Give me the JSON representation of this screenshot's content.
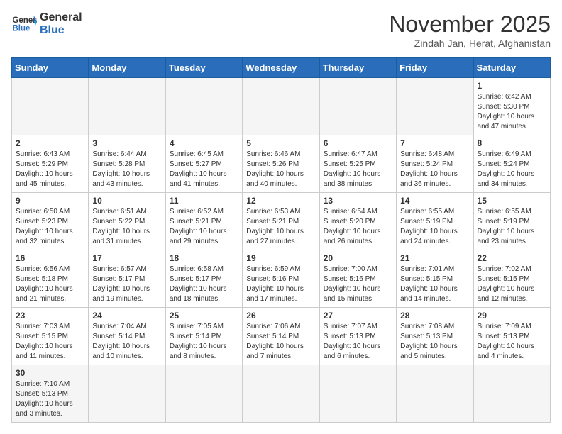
{
  "logo": {
    "line1": "General",
    "line2": "Blue"
  },
  "title": "November 2025",
  "subtitle": "Zindah Jan, Herat, Afghanistan",
  "weekdays": [
    "Sunday",
    "Monday",
    "Tuesday",
    "Wednesday",
    "Thursday",
    "Friday",
    "Saturday"
  ],
  "weeks": [
    [
      {
        "day": "",
        "info": ""
      },
      {
        "day": "",
        "info": ""
      },
      {
        "day": "",
        "info": ""
      },
      {
        "day": "",
        "info": ""
      },
      {
        "day": "",
        "info": ""
      },
      {
        "day": "",
        "info": ""
      },
      {
        "day": "1",
        "info": "Sunrise: 6:42 AM\nSunset: 5:30 PM\nDaylight: 10 hours\nand 47 minutes."
      }
    ],
    [
      {
        "day": "2",
        "info": "Sunrise: 6:43 AM\nSunset: 5:29 PM\nDaylight: 10 hours\nand 45 minutes."
      },
      {
        "day": "3",
        "info": "Sunrise: 6:44 AM\nSunset: 5:28 PM\nDaylight: 10 hours\nand 43 minutes."
      },
      {
        "day": "4",
        "info": "Sunrise: 6:45 AM\nSunset: 5:27 PM\nDaylight: 10 hours\nand 41 minutes."
      },
      {
        "day": "5",
        "info": "Sunrise: 6:46 AM\nSunset: 5:26 PM\nDaylight: 10 hours\nand 40 minutes."
      },
      {
        "day": "6",
        "info": "Sunrise: 6:47 AM\nSunset: 5:25 PM\nDaylight: 10 hours\nand 38 minutes."
      },
      {
        "day": "7",
        "info": "Sunrise: 6:48 AM\nSunset: 5:24 PM\nDaylight: 10 hours\nand 36 minutes."
      },
      {
        "day": "8",
        "info": "Sunrise: 6:49 AM\nSunset: 5:24 PM\nDaylight: 10 hours\nand 34 minutes."
      }
    ],
    [
      {
        "day": "9",
        "info": "Sunrise: 6:50 AM\nSunset: 5:23 PM\nDaylight: 10 hours\nand 32 minutes."
      },
      {
        "day": "10",
        "info": "Sunrise: 6:51 AM\nSunset: 5:22 PM\nDaylight: 10 hours\nand 31 minutes."
      },
      {
        "day": "11",
        "info": "Sunrise: 6:52 AM\nSunset: 5:21 PM\nDaylight: 10 hours\nand 29 minutes."
      },
      {
        "day": "12",
        "info": "Sunrise: 6:53 AM\nSunset: 5:21 PM\nDaylight: 10 hours\nand 27 minutes."
      },
      {
        "day": "13",
        "info": "Sunrise: 6:54 AM\nSunset: 5:20 PM\nDaylight: 10 hours\nand 26 minutes."
      },
      {
        "day": "14",
        "info": "Sunrise: 6:55 AM\nSunset: 5:19 PM\nDaylight: 10 hours\nand 24 minutes."
      },
      {
        "day": "15",
        "info": "Sunrise: 6:55 AM\nSunset: 5:19 PM\nDaylight: 10 hours\nand 23 minutes."
      }
    ],
    [
      {
        "day": "16",
        "info": "Sunrise: 6:56 AM\nSunset: 5:18 PM\nDaylight: 10 hours\nand 21 minutes."
      },
      {
        "day": "17",
        "info": "Sunrise: 6:57 AM\nSunset: 5:17 PM\nDaylight: 10 hours\nand 19 minutes."
      },
      {
        "day": "18",
        "info": "Sunrise: 6:58 AM\nSunset: 5:17 PM\nDaylight: 10 hours\nand 18 minutes."
      },
      {
        "day": "19",
        "info": "Sunrise: 6:59 AM\nSunset: 5:16 PM\nDaylight: 10 hours\nand 17 minutes."
      },
      {
        "day": "20",
        "info": "Sunrise: 7:00 AM\nSunset: 5:16 PM\nDaylight: 10 hours\nand 15 minutes."
      },
      {
        "day": "21",
        "info": "Sunrise: 7:01 AM\nSunset: 5:15 PM\nDaylight: 10 hours\nand 14 minutes."
      },
      {
        "day": "22",
        "info": "Sunrise: 7:02 AM\nSunset: 5:15 PM\nDaylight: 10 hours\nand 12 minutes."
      }
    ],
    [
      {
        "day": "23",
        "info": "Sunrise: 7:03 AM\nSunset: 5:15 PM\nDaylight: 10 hours\nand 11 minutes."
      },
      {
        "day": "24",
        "info": "Sunrise: 7:04 AM\nSunset: 5:14 PM\nDaylight: 10 hours\nand 10 minutes."
      },
      {
        "day": "25",
        "info": "Sunrise: 7:05 AM\nSunset: 5:14 PM\nDaylight: 10 hours\nand 8 minutes."
      },
      {
        "day": "26",
        "info": "Sunrise: 7:06 AM\nSunset: 5:14 PM\nDaylight: 10 hours\nand 7 minutes."
      },
      {
        "day": "27",
        "info": "Sunrise: 7:07 AM\nSunset: 5:13 PM\nDaylight: 10 hours\nand 6 minutes."
      },
      {
        "day": "28",
        "info": "Sunrise: 7:08 AM\nSunset: 5:13 PM\nDaylight: 10 hours\nand 5 minutes."
      },
      {
        "day": "29",
        "info": "Sunrise: 7:09 AM\nSunset: 5:13 PM\nDaylight: 10 hours\nand 4 minutes."
      }
    ],
    [
      {
        "day": "30",
        "info": "Sunrise: 7:10 AM\nSunset: 5:13 PM\nDaylight: 10 hours\nand 3 minutes."
      },
      {
        "day": "",
        "info": ""
      },
      {
        "day": "",
        "info": ""
      },
      {
        "day": "",
        "info": ""
      },
      {
        "day": "",
        "info": ""
      },
      {
        "day": "",
        "info": ""
      },
      {
        "day": "",
        "info": ""
      }
    ]
  ]
}
